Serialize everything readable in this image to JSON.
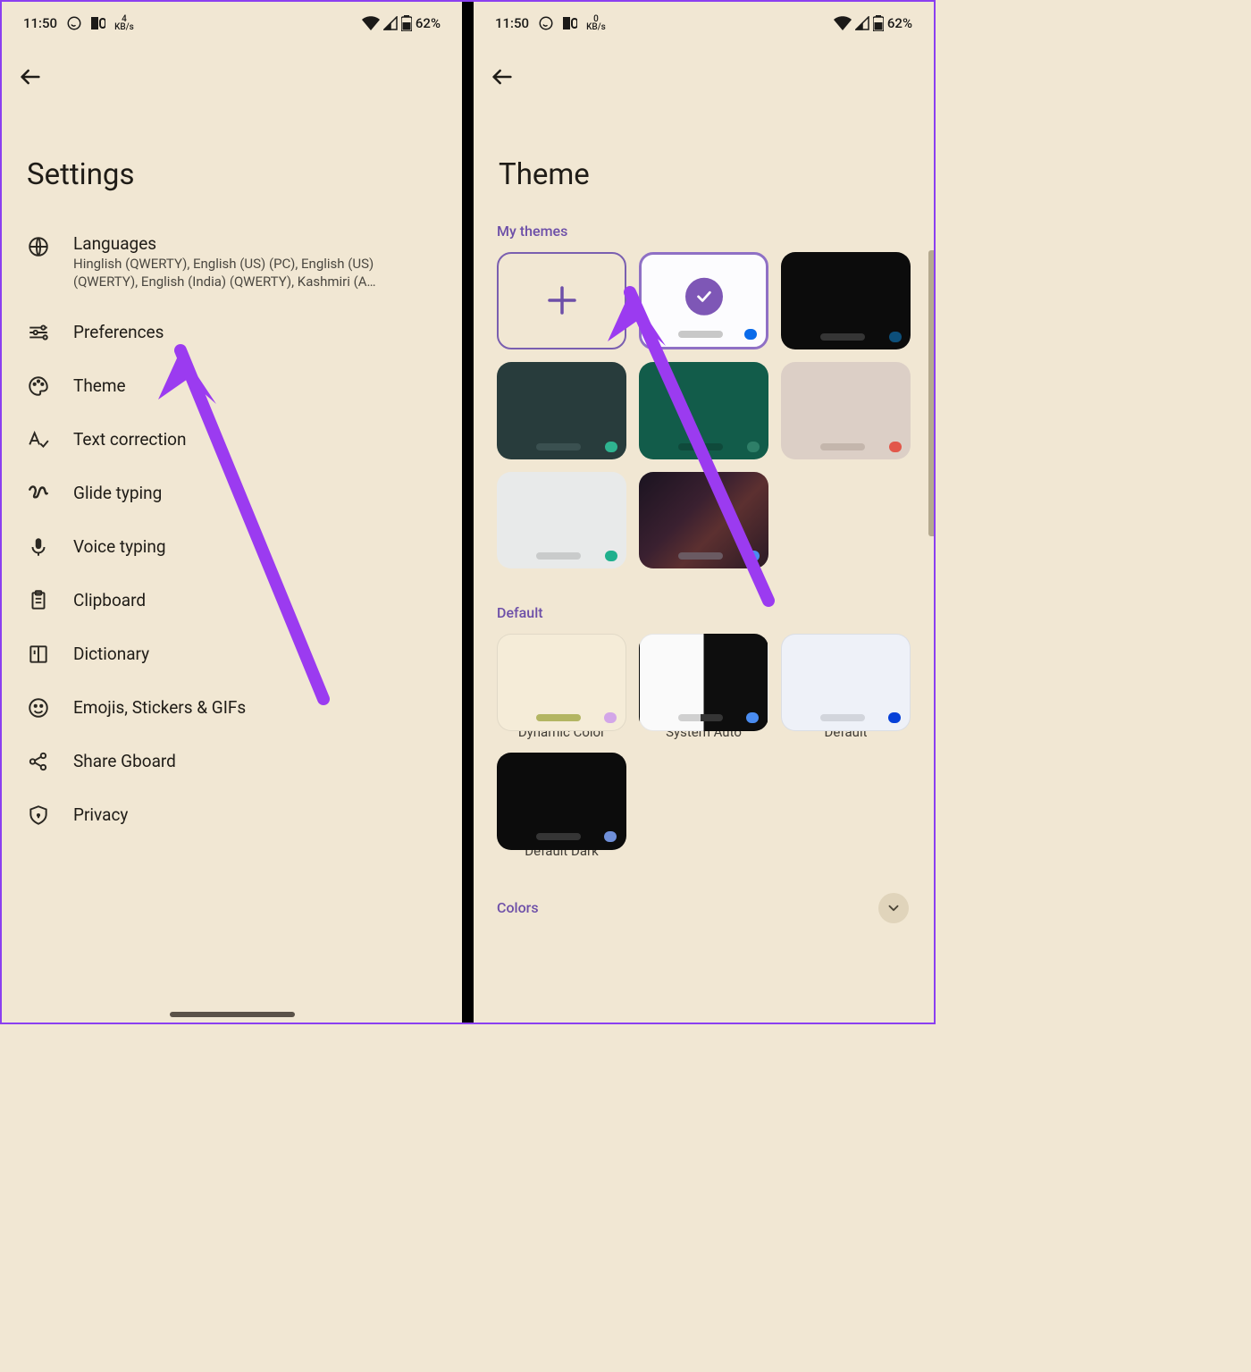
{
  "status": {
    "time": "11:50",
    "kbs1": "4",
    "kbs2": "0",
    "kb_label": "KB/s",
    "battery": "62%"
  },
  "left": {
    "title": "Settings",
    "items": [
      {
        "label": "Languages",
        "sub": "Hinglish (QWERTY), English (US) (PC), English (US) (QWERTY), English (India) (QWERTY), Kashmiri (A…"
      },
      {
        "label": "Preferences"
      },
      {
        "label": "Theme"
      },
      {
        "label": "Text correction"
      },
      {
        "label": "Glide typing"
      },
      {
        "label": "Voice typing"
      },
      {
        "label": "Clipboard"
      },
      {
        "label": "Dictionary"
      },
      {
        "label": "Emojis, Stickers & GIFs"
      },
      {
        "label": "Share Gboard"
      },
      {
        "label": "Privacy"
      }
    ]
  },
  "right": {
    "title": "Theme",
    "my_themes": "My themes",
    "default": "Default",
    "colors": "Colors",
    "default_items": [
      {
        "label": "Dynamic Color"
      },
      {
        "label": "System Auto"
      },
      {
        "label": "Default"
      },
      {
        "label": "Default Dark"
      }
    ],
    "themes": {
      "white": "#fcfcfe",
      "black": "#0c0c0c",
      "darkslate": "#283c3c",
      "teal": "#125c4a",
      "beige": "#dccfc6",
      "lightgray": "#e8eaea",
      "image": "#22151e",
      "dot_blue": "#0a6bea",
      "dot_dkblue": "#0d4f7a",
      "dot_tealAcc": "#2fb390",
      "dot_teal2": "#2e7f68",
      "dot_red": "#e2574a",
      "dot_teal3": "#20b08d",
      "dot_sky": "#4a8cf0",
      "bar_gray": "#b5b5b5",
      "bar_dk": "#353535",
      "bar_slate": "#455a5a",
      "bar_tealdark": "#0f4a3b",
      "bar_beige": "#c4b6ac",
      "bar_lg": "#c9cbcb",
      "bar_img": "#5a4a52",
      "dyn_bg": "#f5ecd8",
      "dyn_bar": "#b3b562",
      "dyn_dot": "#d3a6e8",
      "auto_left": "#fafafa",
      "auto_right": "#0e0e0e",
      "auto_dot": "#4a8cf0",
      "def_bg": "#eef1f8",
      "def_dot": "#0640d8",
      "darkdef": "#0c0c0c",
      "darkdef_dot": "#6f8fd8"
    }
  }
}
